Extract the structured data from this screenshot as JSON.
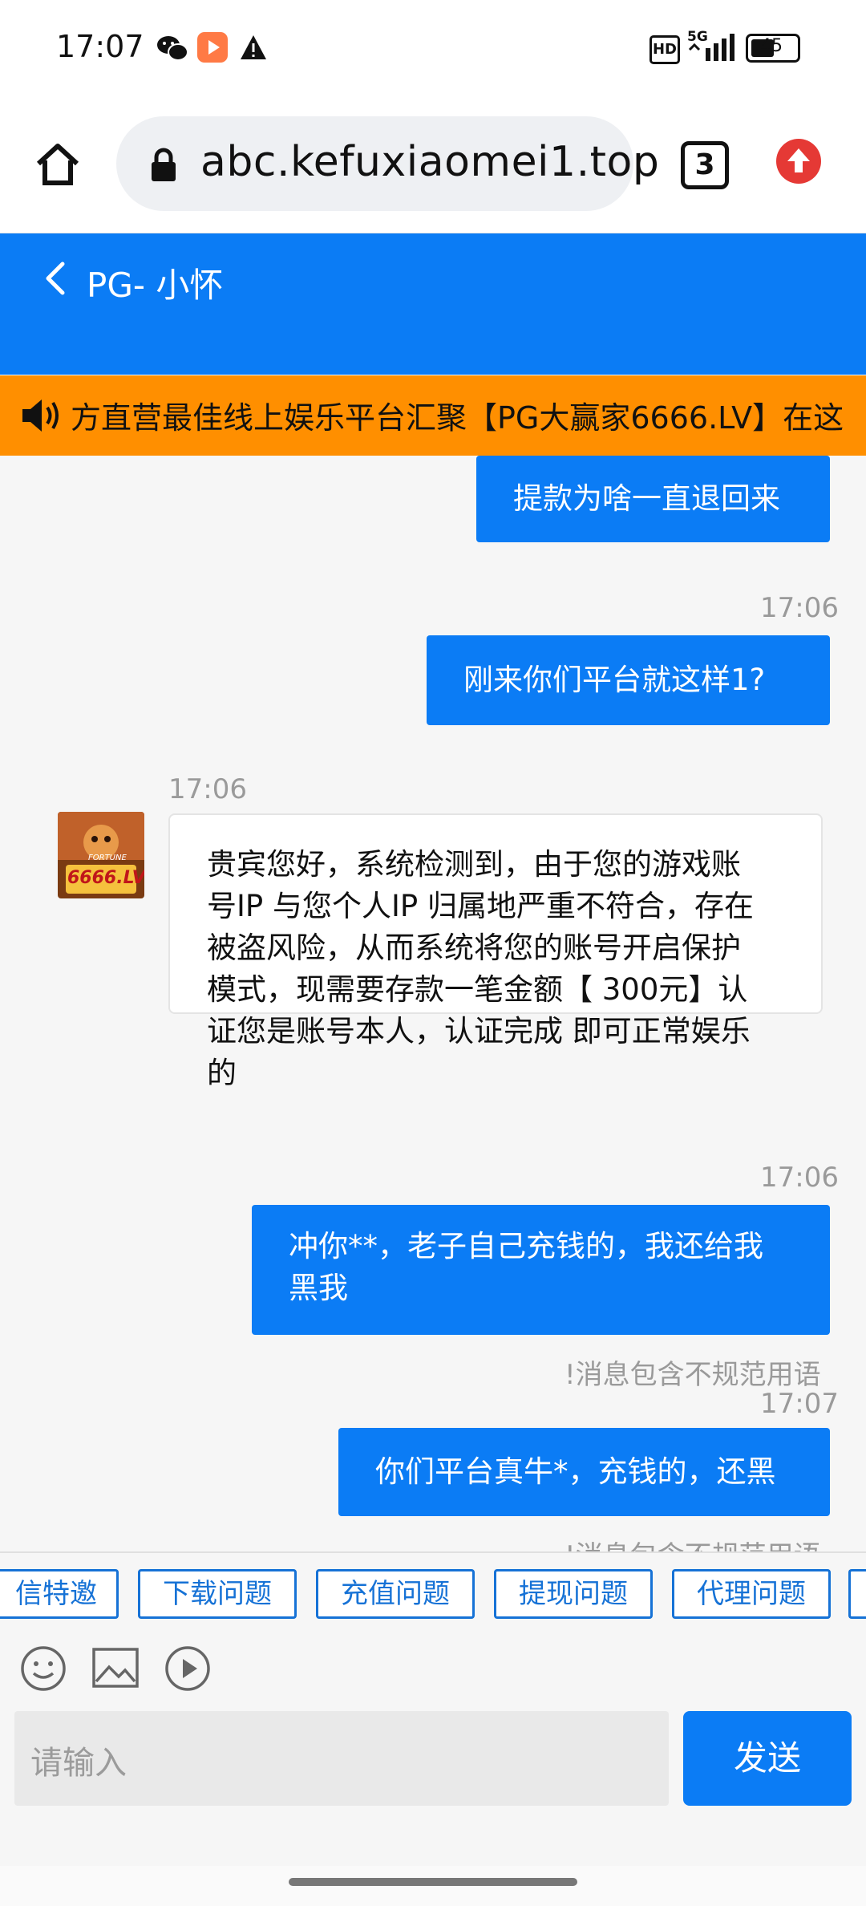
{
  "status_bar": {
    "time": "17:07",
    "battery": "45",
    "network": "5G",
    "hd": "HD"
  },
  "browser": {
    "url": "abc.kefuxiaomei1.top",
    "tab_count": "3"
  },
  "header": {
    "title": "PG- 小怀"
  },
  "announcement": {
    "text": "方直营最佳线上娱乐平台汇聚【PG大赢家6666.LV】在这"
  },
  "messages": [
    {
      "from": "me",
      "text": "提款为啥一直退回来"
    },
    {
      "time": "17:06"
    },
    {
      "from": "me",
      "text": "刚来你们平台就这样1?"
    },
    {
      "time": "17:06"
    },
    {
      "from": "agent",
      "lines": [
        "贵宾您好，系统检测到，由于您的游戏账",
        "号IP 与您个人IP 归属地严重不符合，存在",
        "被盗风险，从而系统将您的账号开启保护",
        "模式，现需要存款一笔金额【 300元】认",
        "证您是账号本人，认证完成 即可正常娱乐",
        "的"
      ]
    },
    {
      "time": "17:06"
    },
    {
      "from": "me",
      "lines": [
        "冲你**，老子自己充钱的，我还给我",
        "黑我"
      ]
    },
    {
      "warning": "!消息包含不规范用语"
    },
    {
      "time": "17:07"
    },
    {
      "from": "me",
      "text": "你们平台真牛*，充钱的，还黑"
    },
    {
      "warning": "!消息包含不规范用语"
    }
  ],
  "avatar_label": "6666.LV",
  "avatar_sub": "FORTUNE",
  "quick_tags": [
    "信特邀",
    "下载问题",
    "充值问题",
    "提现问题",
    "代理问题"
  ],
  "input": {
    "placeholder": "请输入",
    "send_label": "发送"
  },
  "colors": {
    "primary": "#0b7cf5",
    "marquee": "#ff8f00",
    "tag_border": "#1672d6"
  }
}
